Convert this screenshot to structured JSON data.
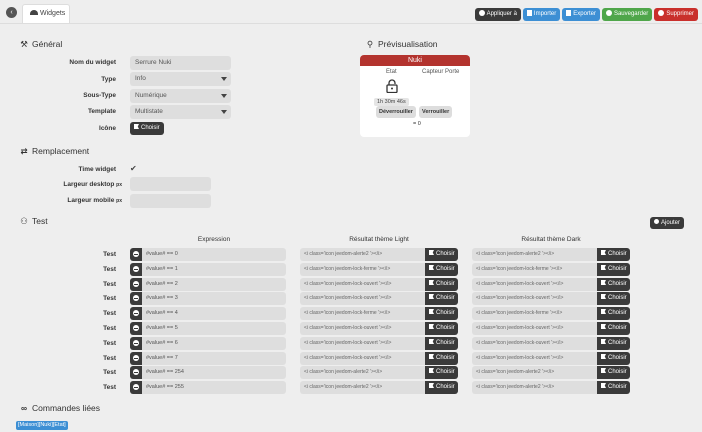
{
  "tab": {
    "label": "Widgets"
  },
  "actions": {
    "apply": "Appliquer à",
    "import": "Importer",
    "export": "Exporter",
    "save": "Sauvegarder",
    "delete": "Supprimer"
  },
  "general": {
    "title": "Général",
    "name_label": "Nom du widget",
    "name_value": "Serrure Nuki",
    "type_label": "Type",
    "type_value": "Info",
    "subtype_label": "Sous-Type",
    "subtype_value": "Numérique",
    "template_label": "Template",
    "template_value": "Multistate",
    "icon_label": "Icône",
    "choose_label": "Choisir"
  },
  "preview": {
    "title": "Prévisualisation",
    "card_title": "Nuki",
    "state_label": "Etat",
    "sensor_label": "Capteur Porte",
    "duration": "1h 30m 46s",
    "unlock_label": "Déverrouiller",
    "lock_label": "Verrouiller",
    "sensor_value": "= 0"
  },
  "replacement": {
    "title": "Remplacement",
    "time_label": "Time widget",
    "desktop_label": "Largeur desktop",
    "mobile_label": "Largeur mobile",
    "unit": "px"
  },
  "test": {
    "title": "Test",
    "add_label": "Ajouter",
    "col_expression": "Expression",
    "col_light": "Résultat thème Light",
    "col_dark": "Résultat thème Dark",
    "row_label": "Test",
    "choose_label": "Choisir",
    "rows": [
      {
        "expr": "#value# == 0",
        "light": "<i class='icon jeedom-alerte2 '></i>",
        "dark": "<i class='icon jeedom-alerte2 '></i>"
      },
      {
        "expr": "#value# == 1",
        "light": "<i class='icon jeedom-lock-ferme '></i>",
        "dark": "<i class='icon jeedom-lock-ferme '></i>"
      },
      {
        "expr": "#value# == 2",
        "light": "<i class='icon jeedom-lock-ouvert '></i>",
        "dark": "<i class='icon jeedom-lock-ouvert '></i>"
      },
      {
        "expr": "#value# == 3",
        "light": "<i class='icon jeedom-lock-ouvert '></i>",
        "dark": "<i class='icon jeedom-lock-ouvert '></i>"
      },
      {
        "expr": "#value# == 4",
        "light": "<i class='icon jeedom-lock-ferme '></i>",
        "dark": "<i class='icon jeedom-lock-ferme '></i>"
      },
      {
        "expr": "#value# == 5",
        "light": "<i class='icon jeedom-lock-ouvert '></i>",
        "dark": "<i class='icon jeedom-lock-ouvert '></i>"
      },
      {
        "expr": "#value# == 6",
        "light": "<i class='icon jeedom-lock-ouvert '></i>",
        "dark": "<i class='icon jeedom-lock-ouvert '></i>"
      },
      {
        "expr": "#value# == 7",
        "light": "<i class='icon jeedom-lock-ouvert '></i>",
        "dark": "<i class='icon jeedom-lock-ouvert '></i>"
      },
      {
        "expr": "#value# == 254",
        "light": "<i class='icon jeedom-alerte2 '></i>",
        "dark": "<i class='icon jeedom-alerte2 '></i>"
      },
      {
        "expr": "#value# == 255",
        "light": "<i class='icon jeedom-alerte2 '></i>",
        "dark": "<i class='icon jeedom-alerte2 '></i>"
      }
    ]
  },
  "linked": {
    "title": "Commandes liées",
    "command": "[Maison][Nuki][Etat]"
  },
  "colors": {
    "accent_red": "#b3332e",
    "blue": "#3d8fd4",
    "green": "#4fa64a",
    "dark": "#3a3a3a"
  }
}
